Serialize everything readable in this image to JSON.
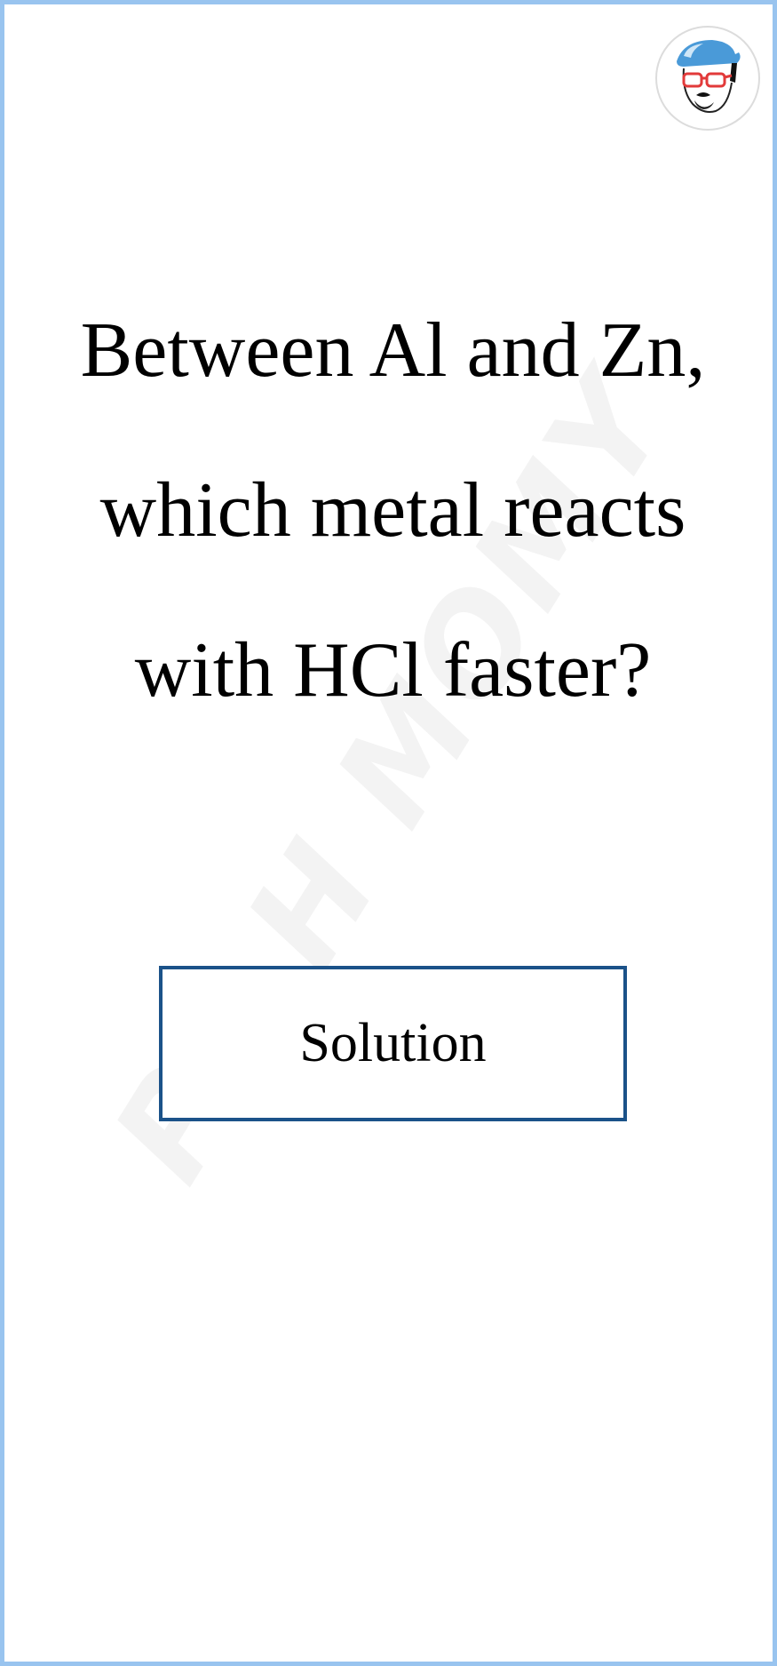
{
  "question": {
    "text": "Between Al and Zn, which metal reacts with HCl faster?"
  },
  "solution_button": {
    "label": "Solution"
  },
  "watermark": {
    "text": "PA H MOMY"
  },
  "colors": {
    "frame_border": "#99c4ef",
    "button_border": "#1b5289",
    "watermark": "#f3f3f3",
    "text": "#000000"
  },
  "icons": {
    "avatar": "cartoon-face-with-cap-and-glasses"
  }
}
